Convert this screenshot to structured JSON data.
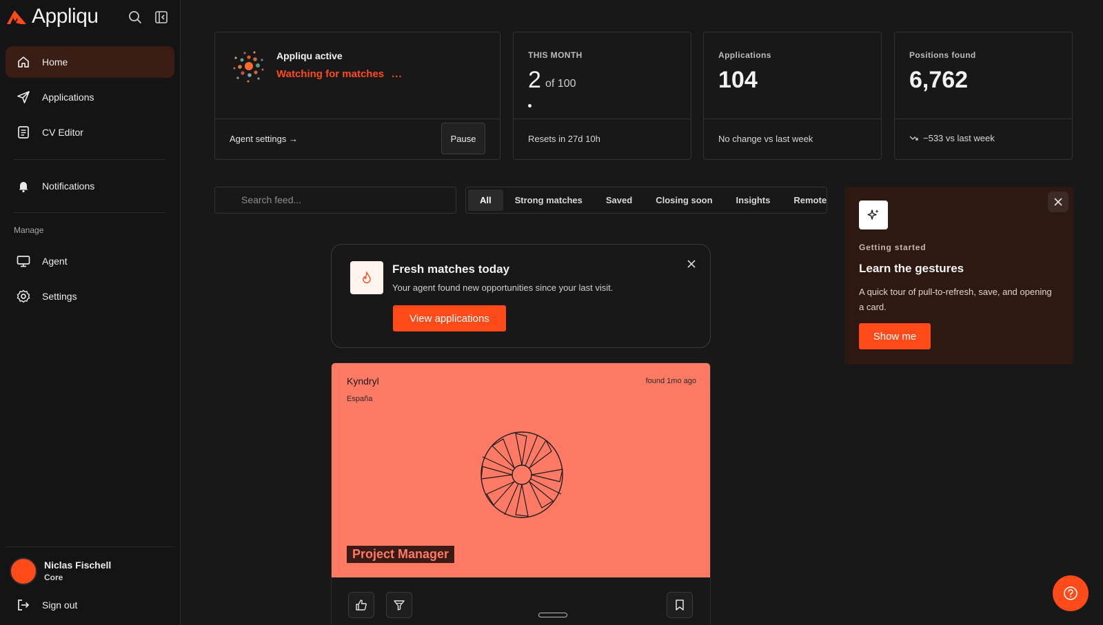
{
  "brand": {
    "name": "Appliqu",
    "accent": "#ff4a1a"
  },
  "sidebar": {
    "items": [
      {
        "label": "Home",
        "icon": "home-icon",
        "active": true
      },
      {
        "label": "Applications",
        "icon": "send-icon"
      },
      {
        "label": "CV Editor",
        "icon": "document-icon"
      },
      {
        "label": "Notifications",
        "icon": "bell-icon"
      },
      {
        "label": "Agent",
        "icon": "monitor-icon"
      },
      {
        "label": "Settings",
        "icon": "gear-icon"
      }
    ],
    "section_manage": "Manage",
    "user": {
      "name": "Niclas Fischell",
      "plan": "Core"
    },
    "sign_out": "Sign out"
  },
  "agent_card": {
    "title": "Appliqu active",
    "status": "Watching for matches",
    "settings_link": "Agent settings →",
    "pause": "Pause"
  },
  "stats": {
    "month": {
      "label": "THIS MONTH",
      "value": "2",
      "of": "of 100",
      "progress": 0.02,
      "foot": "Resets in 27d 10h"
    },
    "applications": {
      "label": "Applications",
      "value": "104",
      "foot": "No change vs last week"
    },
    "positions": {
      "label": "Positions found",
      "value": "6,762",
      "foot": "−533 vs last week"
    }
  },
  "feed": {
    "search_placeholder": "Search feed...",
    "tabs": [
      "All",
      "Strong matches",
      "Saved",
      "Closing soon",
      "Insights",
      "Remote"
    ],
    "active_tab": "All"
  },
  "fresh": {
    "title": "Fresh matches today",
    "subtitle": "Your agent found new opportunities since your last visit.",
    "button": "View applications"
  },
  "job": {
    "company": "Kyndryl",
    "location": "España",
    "found": "found 1mo ago",
    "title": "Project Manager",
    "color": "#ff7a64"
  },
  "getting_started": {
    "label": "Getting started",
    "title": "Learn the gestures",
    "text": "A quick tour of pull-to-refresh, save, and opening a card.",
    "button": "Show me"
  }
}
